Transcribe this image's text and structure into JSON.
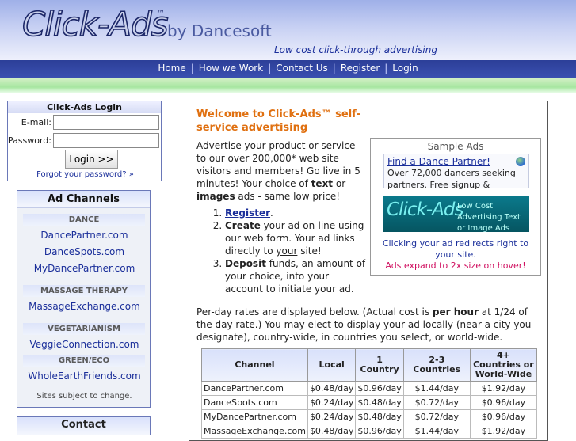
{
  "header": {
    "logo": "Click-Ads",
    "tm": "™",
    "by": "by Dancesoft",
    "tagline": "Low cost click-through advertising"
  },
  "nav": [
    {
      "label": "Home"
    },
    {
      "label": "How we Work"
    },
    {
      "label": "Contact Us"
    },
    {
      "label": "Register"
    },
    {
      "label": "Login"
    }
  ],
  "login": {
    "title": "Click-Ads Login",
    "email_label": "E-mail:",
    "password_label": "Password:",
    "email_value": "",
    "password_value": "",
    "button": "Login >>",
    "forgot": "Forgot your password? »"
  },
  "channels": {
    "title": "Ad Channels",
    "categories": [
      {
        "name": "DANCE",
        "links": [
          "DancePartner.com",
          "DanceSpots.com",
          "MyDancePartner.com"
        ]
      },
      {
        "name": "MASSAGE THERAPY",
        "links": [
          "MassageExchange.com"
        ]
      },
      {
        "name": "VEGETARIANISM",
        "links": [
          "VeggieConnection.com"
        ]
      },
      {
        "name": "GREEN/ECO",
        "links": [
          "WholeEarthFriends.com"
        ]
      }
    ],
    "note": "Sites subject to change."
  },
  "contact": {
    "title": "Contact"
  },
  "main": {
    "welcome": "Welcome to Click-Ads™ self-service advertising",
    "intro_1": "Advertise your product or service to our over 200,000* web site visitors and members! Go live in 5 minutes! Your choice of ",
    "intro_text": "text",
    "intro_or": " or ",
    "intro_images": "images",
    "intro_2": " ads - same low price!",
    "steps": [
      {
        "lead": "Register",
        "rest": "."
      },
      {
        "lead": "Create",
        "rest_1": " your ad on-line using our web form. Your ad links directly to ",
        "your": "your",
        "rest_2": " site!"
      },
      {
        "lead": "Deposit",
        "rest": " funds, an amount of your choice, into your account to initiate your ad."
      }
    ],
    "rates_1": "Per-day rates are displayed below. (Actual cost is ",
    "rates_bold": "per hour",
    "rates_2": " at 1/24 of the day rate.) You may elect to display your ad locally (near a city you designate), country-wide, in countries you select, or world-wide."
  },
  "sample": {
    "title": "Sample Ads",
    "ad1_link": "Find a Dance Partner!",
    "ad1_text": "Over 72,000 dancers seeking partners. Free signup &",
    "ad2_big": "Click-Ads",
    "ad2_small": "Low Cost Advertising Text or Image Ads",
    "note": "Clicking your ad redirects right to your site.",
    "hover": "Ads expand to 2x size on hover!"
  },
  "rates_table": {
    "headers": [
      "Channel",
      "Local",
      "1 Country",
      "2-3 Countries",
      "4+ Countries or World-Wide"
    ],
    "rows": [
      [
        "DancePartner.com",
        "$0.48/day",
        "$0.96/day",
        "$1.44/day",
        "$1.92/day"
      ],
      [
        "DanceSpots.com",
        "$0.24/day",
        "$0.48/day",
        "$0.72/day",
        "$0.96/day"
      ],
      [
        "MyDancePartner.com",
        "$0.24/day",
        "$0.48/day",
        "$0.72/day",
        "$0.96/day"
      ],
      [
        "MassageExchange.com",
        "$0.48/day",
        "$0.96/day",
        "$1.44/day",
        "$1.92/day"
      ]
    ]
  }
}
